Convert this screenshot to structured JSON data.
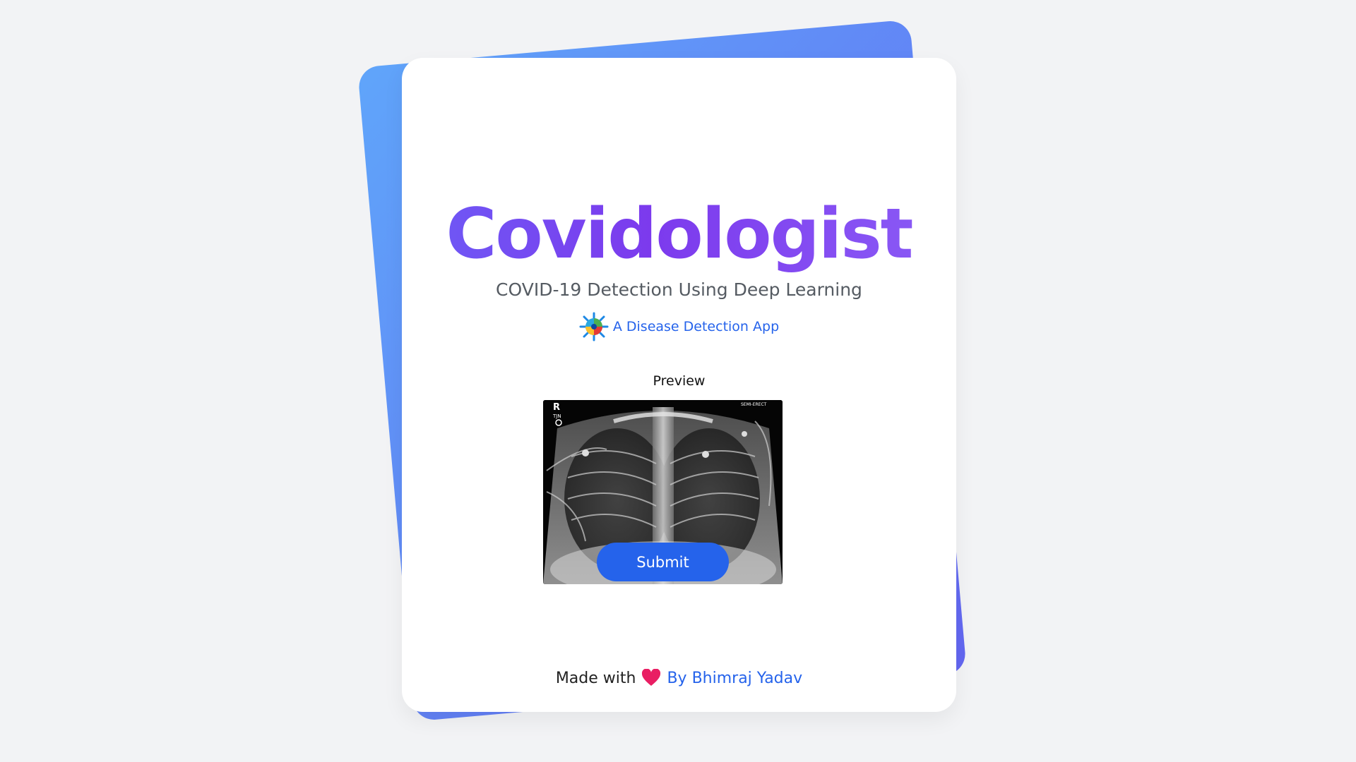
{
  "app": {
    "title": "Covidologist",
    "subtitle": "COVID-19 Detection Using Deep Learning",
    "app_link_label": "A Disease Detection App",
    "app_icon": "virus-icon"
  },
  "preview": {
    "label": "Preview",
    "image_description": "chest-xray",
    "image_overlay_left": "R",
    "image_overlay_left_sub": "TJN",
    "image_overlay_right": "SEMI-ERECT"
  },
  "actions": {
    "submit_label": "Submit"
  },
  "footer": {
    "made_with": "Made with",
    "heart_icon": "heart-icon",
    "author": "By Bhimraj Yadav"
  },
  "colors": {
    "background": "#f2f3f5",
    "card": "#ffffff",
    "accent_blue": "#2563eb",
    "back_card_start": "#60a5fa",
    "back_card_end": "#6366f1",
    "title_gradient_start": "#6d5cf6",
    "title_gradient_end": "#8b5cf6",
    "heart": "#e91e63"
  }
}
